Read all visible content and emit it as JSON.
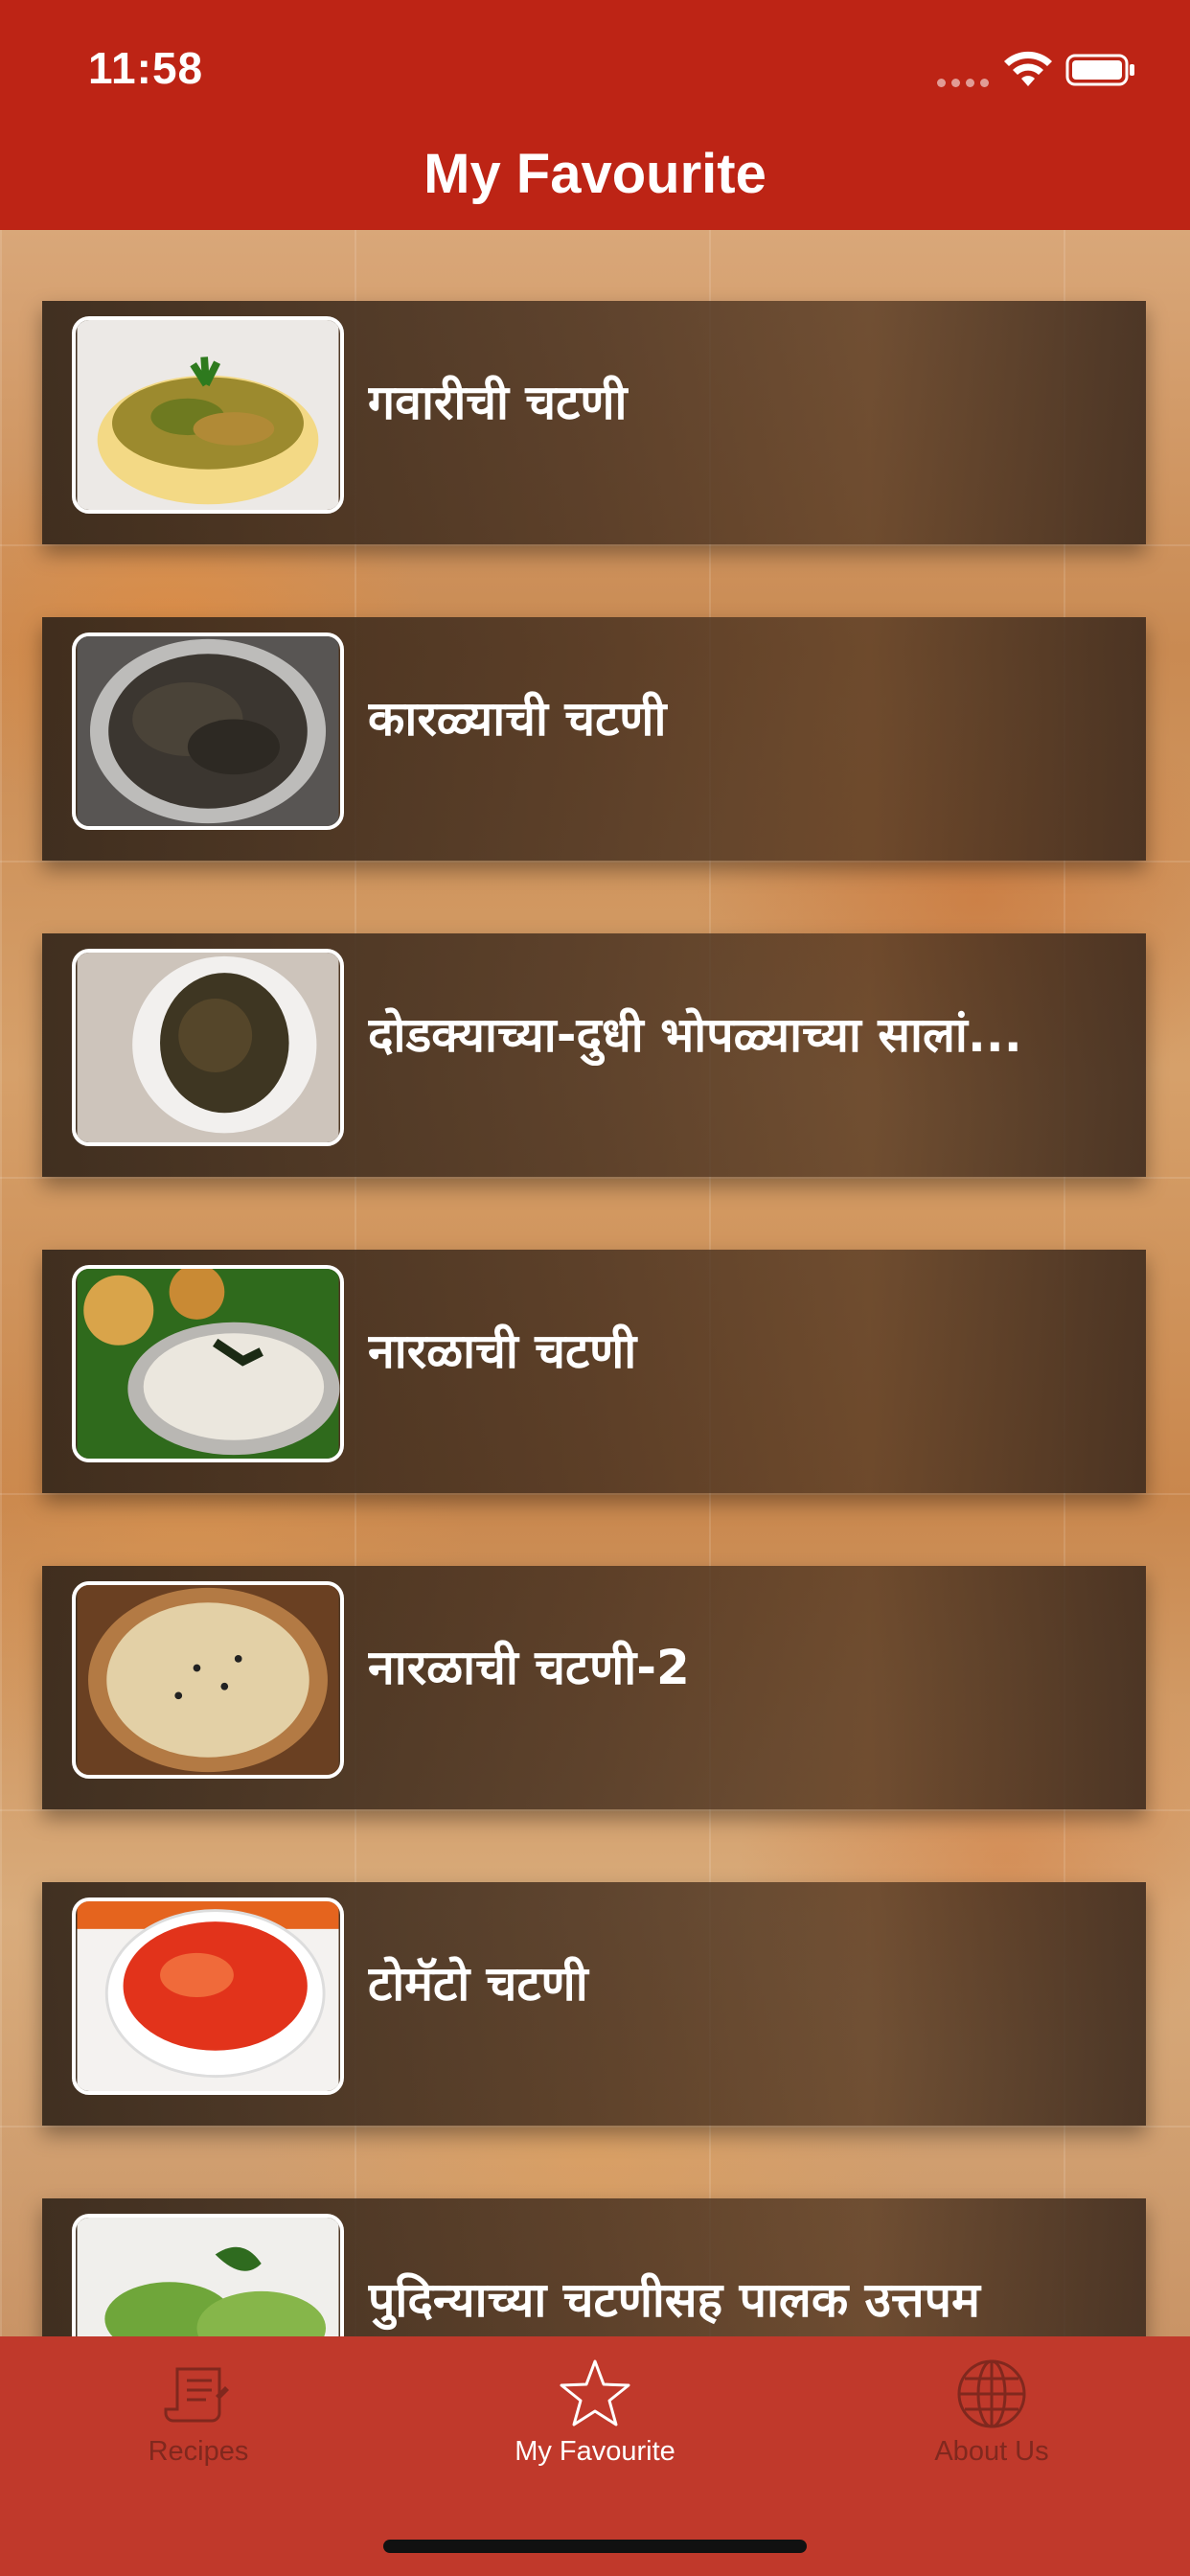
{
  "status_bar": {
    "time": "11:58"
  },
  "header": {
    "title": "My Favourite"
  },
  "recipes": [
    {
      "title": "गवारीची चटणी",
      "thumb_icon": "cluster-beans-chutney-photo"
    },
    {
      "title": "कारळ्याची चटणी",
      "thumb_icon": "niger-seed-chutney-photo"
    },
    {
      "title": "दोडक्याच्या-दुधी भोपळ्याच्या सालां...",
      "thumb_icon": "peel-chutney-photo"
    },
    {
      "title": "नारळाची चटणी",
      "thumb_icon": "coconut-chutney-photo"
    },
    {
      "title": "नारळाची चटणी-2",
      "thumb_icon": "coconut-chutney-2-photo"
    },
    {
      "title": "टोमॅटो चटणी",
      "thumb_icon": "tomato-chutney-photo"
    },
    {
      "title": "पुदिन्याच्या चटणीसह पालक उत्तपम",
      "thumb_icon": "palak-uttapam-photo"
    }
  ],
  "tabs": [
    {
      "label": "Recipes",
      "icon": "recipe-scroll-icon",
      "active": false
    },
    {
      "label": "My Favourite",
      "icon": "star-icon",
      "active": true
    },
    {
      "label": "About Us",
      "icon": "globe-icon",
      "active": false
    }
  ],
  "colors": {
    "header_red": "#bd2415",
    "tab_bar_red": "#c0392b",
    "tab_inactive": "#80281e",
    "tab_active": "#ffffff",
    "card_brown": "#3f2c1e"
  }
}
